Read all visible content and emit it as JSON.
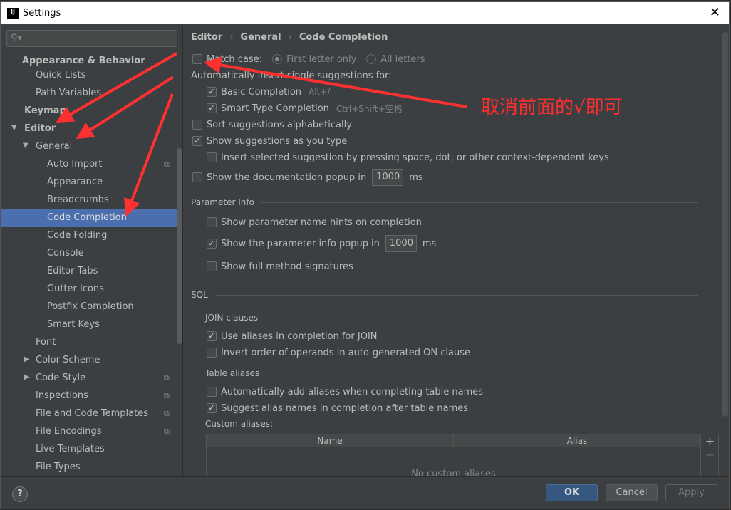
{
  "window": {
    "title": "Settings",
    "logo": "IJ"
  },
  "sidebar": {
    "search_placeholder": "",
    "items": [
      {
        "label": "Appearance & Behavior"
      },
      {
        "label": "Quick Lists"
      },
      {
        "label": "Path Variables"
      },
      {
        "label": "Keymap"
      },
      {
        "label": "Editor"
      },
      {
        "label": "General"
      },
      {
        "label": "Auto Import"
      },
      {
        "label": "Appearance"
      },
      {
        "label": "Breadcrumbs"
      },
      {
        "label": "Code Completion"
      },
      {
        "label": "Code Folding"
      },
      {
        "label": "Console"
      },
      {
        "label": "Editor Tabs"
      },
      {
        "label": "Gutter Icons"
      },
      {
        "label": "Postfix Completion"
      },
      {
        "label": "Smart Keys"
      },
      {
        "label": "Font"
      },
      {
        "label": "Color Scheme"
      },
      {
        "label": "Code Style"
      },
      {
        "label": "Inspections"
      },
      {
        "label": "File and Code Templates"
      },
      {
        "label": "File Encodings"
      },
      {
        "label": "Live Templates"
      },
      {
        "label": "File Types"
      }
    ]
  },
  "breadcrumb": [
    "Editor",
    "General",
    "Code Completion"
  ],
  "main": {
    "match_case": {
      "label": "Match case:",
      "checked": false,
      "opt1": "First letter only",
      "opt2": "All letters",
      "selected": "First letter only"
    },
    "auto_insert_label": "Automatically insert single suggestions for:",
    "basic": {
      "label": "Basic Completion",
      "hint": "Alt+/",
      "checked": true
    },
    "smart": {
      "label": "Smart Type Completion",
      "hint": "Ctrl+Shift+空格",
      "checked": true
    },
    "sort": {
      "label": "Sort suggestions alphabetically",
      "checked": false
    },
    "show_as_type": {
      "label": "Show suggestions as you type",
      "checked": true
    },
    "insert_sel": {
      "label": "Insert selected suggestion by pressing space, dot, or other context-dependent keys",
      "checked": false
    },
    "doc_popup": {
      "label": "Show the documentation popup in",
      "value": "1000",
      "unit": "ms",
      "checked": false
    },
    "param_info": "Parameter Info",
    "param_hints": {
      "label": "Show parameter name hints on completion",
      "checked": false
    },
    "param_popup": {
      "label": "Show the parameter info popup in",
      "value": "1000",
      "unit": "ms",
      "checked": true
    },
    "full_sig": {
      "label": "Show full method signatures",
      "checked": false
    },
    "sql": "SQL",
    "join_clauses": "JOIN clauses",
    "use_aliases": {
      "label": "Use aliases in completion for JOIN",
      "checked": true
    },
    "invert": {
      "label": "Invert order of operands in auto-generated ON clause",
      "checked": false
    },
    "table_aliases": "Table aliases",
    "auto_add": {
      "label": "Automatically add aliases when completing table names",
      "checked": false
    },
    "suggest_alias": {
      "label": "Suggest alias names in completion after table names",
      "checked": true
    },
    "custom_aliases": "Custom aliases:",
    "table": {
      "columns": [
        "Name",
        "Alias"
      ],
      "empty": "No custom aliases"
    },
    "add": "+",
    "remove": "−"
  },
  "buttons": {
    "help": "?",
    "ok": "OK",
    "cancel": "Cancel",
    "apply": "Apply"
  },
  "annotation": {
    "text": "取消前面的√即可",
    "color": "#ff2d2d"
  },
  "colors": {
    "selection": "#4b6eaf",
    "background": "#3c3f41",
    "ok": "#365880"
  }
}
